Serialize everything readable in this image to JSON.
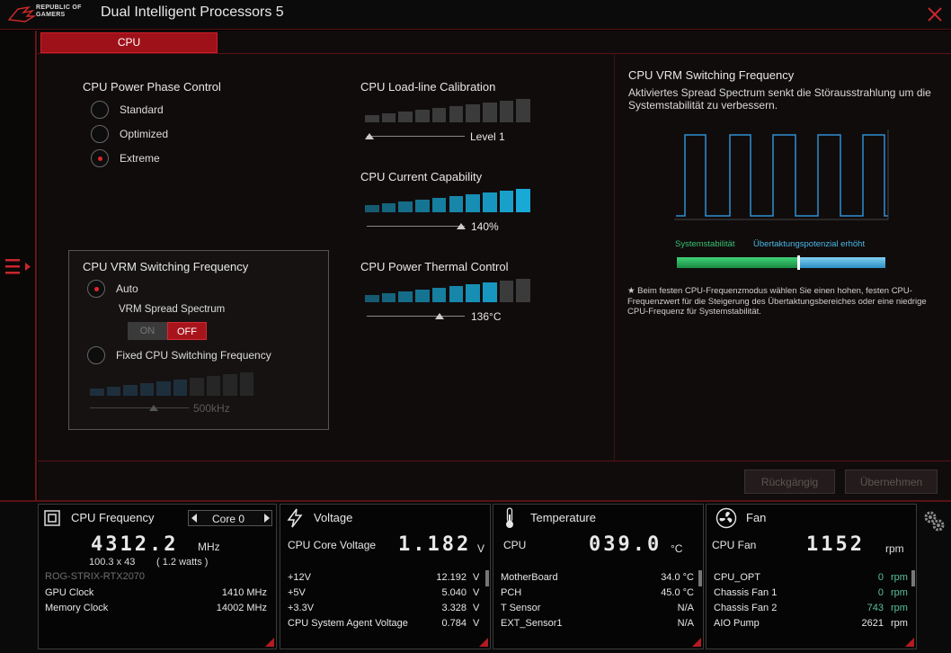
{
  "window": {
    "logo_line1": "REPUBLIC OF",
    "logo_line2": "GAMERS",
    "title": "Dual Intelligent Processors 5",
    "close_icon": "close-x-icon",
    "menu_icon": "menu-expand-icon"
  },
  "tabs": [
    {
      "label": "CPU",
      "active": true
    }
  ],
  "phase_control": {
    "title": "CPU Power Phase Control",
    "options": [
      {
        "label": "Standard",
        "selected": false
      },
      {
        "label": "Optimized",
        "selected": false
      },
      {
        "label": "Extreme",
        "selected": true
      }
    ]
  },
  "vrm_frequency": {
    "title": "CPU VRM Switching Frequency",
    "auto_label": "Auto",
    "auto_selected": true,
    "spread_label": "VRM Spread Spectrum",
    "toggle_on": "ON",
    "toggle_off": "OFF",
    "toggle_state": "OFF",
    "fixed_label": "Fixed CPU Switching Frequency",
    "fixed_selected": false,
    "fixed_value": "500kHz",
    "fixed_level": 6,
    "fixed_levels_total": 10
  },
  "loadline": {
    "title": "CPU Load-line Calibration",
    "value": "Level 1",
    "level": 0,
    "levels_total": 10
  },
  "current": {
    "title": "CPU Current Capability",
    "value": "140%",
    "level": 10,
    "levels_total": 10
  },
  "thermal": {
    "title": "CPU Power Thermal Control",
    "value": "136°C",
    "level": 8,
    "levels_total": 10
  },
  "colors": {
    "accent_red": "#9e1119",
    "bar_blue": "#19a9d6",
    "bar_dim": "#3b3b3b",
    "green": "#2fb85f"
  },
  "right_panel": {
    "title": "CPU VRM Switching Frequency",
    "description": "Aktiviertes Spread Spectrum senkt die Störausstrahlung um die Systemstabilität zu verbessern.",
    "stability_label": "Systemstabilität",
    "overclock_label": "Übertaktungspotenzial erhöht",
    "stability_level": 0.58,
    "note_star": "★",
    "note": "Beim festen CPU-Frequenzmodus wählen Sie einen hohen, festen CPU-Frequenzwert für die Steigerung des Übertaktungsbereiches oder eine niedrige CPU-Frequenz für Systemstabilität."
  },
  "actions": {
    "undo": "Rückgängig",
    "apply": "Übernehmen"
  },
  "bottom": {
    "cpu_freq": {
      "icon": "cpu-chip-icon",
      "title": "CPU Frequency",
      "core_select": "Core 0",
      "value": "4312.2",
      "unit": "MHz",
      "detail1": "100.3  x  43",
      "detail2": "(  1.2   watts  )",
      "gpu_name": "ROG-STRIX-RTX2070",
      "rows": [
        {
          "name": "GPU Clock",
          "value": "1410 MHz"
        },
        {
          "name": "Memory Clock",
          "value": "14002 MHz"
        }
      ]
    },
    "voltage": {
      "icon": "lightning-bolt-icon",
      "title": "Voltage",
      "main_label": "CPU Core Voltage",
      "value": "1.182",
      "unit": "V",
      "rows": [
        {
          "name": "+12V",
          "value": "12.192",
          "unit": "V"
        },
        {
          "name": "+5V",
          "value": "5.040",
          "unit": "V"
        },
        {
          "name": "+3.3V",
          "value": "3.328",
          "unit": "V"
        },
        {
          "name": "CPU System Agent Voltage",
          "value": "0.784",
          "unit": "V"
        }
      ]
    },
    "temperature": {
      "icon": "thermometer-icon",
      "title": "Temperature",
      "main_label": "CPU",
      "value": "039.0",
      "unit": "°C",
      "rows": [
        {
          "name": "MotherBoard",
          "value": "34.0 °C"
        },
        {
          "name": "PCH",
          "value": "45.0 °C"
        },
        {
          "name": "T Sensor",
          "value": "N/A"
        },
        {
          "name": "EXT_Sensor1",
          "value": "N/A"
        }
      ]
    },
    "fan": {
      "icon": "fan-icon",
      "title": "Fan",
      "main_label": "CPU Fan",
      "value": "1152",
      "unit": "rpm",
      "rows": [
        {
          "name": "CPU_OPT",
          "value": "0",
          "unit": "rpm"
        },
        {
          "name": "Chassis Fan 1",
          "value": "0",
          "unit": "rpm"
        },
        {
          "name": "Chassis Fan 2",
          "value": "743",
          "unit": "rpm"
        },
        {
          "name": "AIO Pump",
          "value": "2621",
          "unit": "rpm"
        }
      ]
    },
    "settings_icon": "gears-icon"
  }
}
